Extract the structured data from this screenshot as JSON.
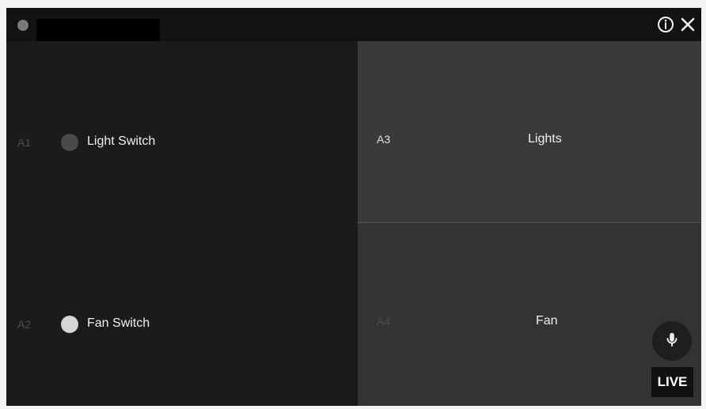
{
  "left": {
    "items": [
      {
        "addr": "A1",
        "label": "Light Switch",
        "state": "off"
      },
      {
        "addr": "A2",
        "label": "Fan Switch",
        "state": "on"
      }
    ]
  },
  "right": {
    "top": {
      "addr": "A3",
      "label": "Lights"
    },
    "bottom": {
      "addr": "A4",
      "label": "Fan"
    }
  },
  "live_label": "LIVE",
  "icons": {
    "status": "status-dot-icon",
    "info": "info-icon",
    "close": "close-icon",
    "toggle_off": "toggle-off-icon",
    "toggle_on": "toggle-on-icon",
    "mic": "microphone-icon"
  },
  "colors": {
    "bg": "#1b1b1b",
    "panel_top": "#3a3a3a",
    "panel_bottom": "#333333",
    "toggle_off": "#4a4a4a",
    "toggle_on": "#d6d6d6",
    "addr": "#4e4e4e",
    "text": "#f0f0f0"
  }
}
